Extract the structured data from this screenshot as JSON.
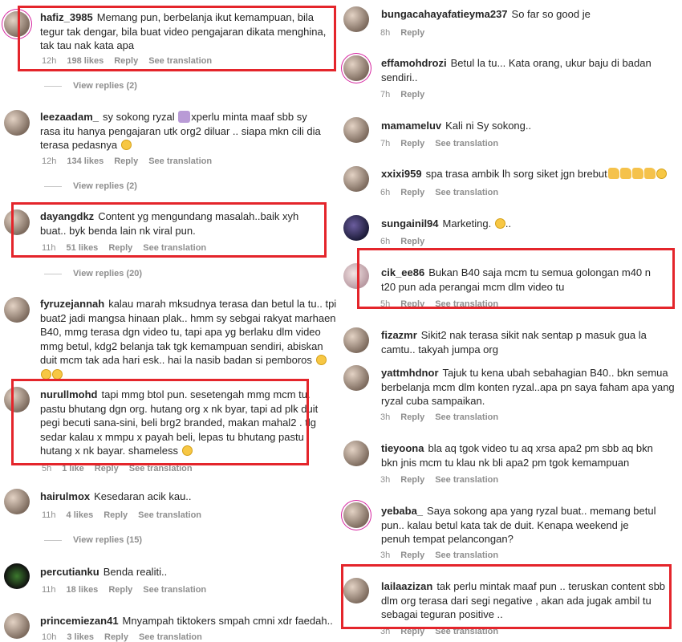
{
  "ui": {
    "reply": "Reply",
    "see_translation": "See translation",
    "view_replies_prefix": "View replies"
  },
  "left_column": [
    {
      "user": "hafiz_3985",
      "text": "Memang pun, berbelanja ikut kemampuan, bila tegur tak dengar, bila buat video pengajaran dikata menghina, tak tau nak kata apa",
      "time": "12h",
      "likes": "198 likes",
      "view_replies": "View replies (2)"
    },
    {
      "user": "leezaadam_",
      "text": "sy sokong ryzal",
      "text_b": "xperlu minta maaf sbb sy rasa itu hanya pengajaran utk org2 diluar .. siapa mkn cili dia terasa pedasnya",
      "time": "12h",
      "likes": "134 likes",
      "view_replies": "View replies (2)"
    },
    {
      "user": "dayangdkz",
      "text": "Content yg mengundang masalah..baik xyh buat.. byk benda lain nk viral pun.",
      "time": "11h",
      "likes": "51 likes",
      "view_replies": "View replies (20)"
    },
    {
      "user": "fyruzejannah",
      "text": "kalau marah mksudnya terasa dan betul la tu.. tpi buat2 jadi mangsa hinaan plak.. hmm sy sebgai rakyat marhaen B40, mmg terasa dgn video tu, tapi apa yg berlaku dlm video mmg betul, kdg2 belanja tak tgk kemampuan sendiri, abiskan duit mcm tak ada hari esk.. hai la nasib badan si pemboros"
    },
    {
      "user": "nurullmohd",
      "text": "tapi mmg btol pun. sesetengah mmg mcm tu. pastu bhutang dgn org. hutang org x nk byar, tapi ad plk duit pegi becuti sana-sini, beli brg2 branded, makan mahal2 . tlg sedar kalau x mmpu x payah beli, lepas tu bhutang pastu hutang x nk bayar. shameless",
      "time": "5h",
      "likes": "1 like",
      "view_replies": "View replies (15)"
    },
    {
      "user": "hairulmox",
      "text": "Kesedaran acik kau..",
      "time": "11h",
      "likes": "4 likes"
    },
    {
      "user": "percutianku",
      "text": "Benda realiti..",
      "time": "11h",
      "likes": "18 likes"
    },
    {
      "user": "princemiezan41",
      "text": "Mnyampah tiktokers smpah cmni xdr faedah..",
      "time": "10h",
      "likes": "3 likes"
    }
  ],
  "right_column": [
    {
      "user": "bungacahayafatieyma237",
      "text": "So far so good je",
      "time": "8h"
    },
    {
      "user": "effamohdrozi",
      "text": "Betul la tu... Kata orang, ukur baju di badan sendiri..",
      "time": "7h"
    },
    {
      "user": "mamameluv",
      "text": "Kali ni Sy sokong..",
      "time": "7h"
    },
    {
      "user": "xxixi959",
      "text": "spa trasa ambik lh sorg siket jgn brebut",
      "time": "6h"
    },
    {
      "user": "sungainil94",
      "text": "Marketing.",
      "text_b": "..",
      "time": "6h"
    },
    {
      "user": "cik_ee86",
      "text": "Bukan B40 saja mcm tu semua golongan m40 n t20 pun ada perangai mcm dlm video tu",
      "time": "5h"
    },
    {
      "user": "fizazmr",
      "text": "Sikit2 nak terasa sikit nak sentap p masuk gua la camtu.. takyah jumpa org"
    },
    {
      "user": "yattmhdnor",
      "text": "Tajuk tu kena ubah sebahagian B40.. bkn semua berbelanja mcm dlm konten ryzal..apa pn saya faham apa yang ryzal cuba sampaikan.",
      "time": "3h"
    },
    {
      "user": "tieyoona",
      "text": "bla aq tgok video tu aq xrsa apa2 pm sbb aq bkn bkn jnis mcm tu klau nk bli apa2 pm tgok kemampuan",
      "time": "3h"
    },
    {
      "user": "yebaba_",
      "text": "Saya sokong apa yang ryzal buat.. memang betul pun.. kalau betul kata tak de duit. Kenapa weekend je penuh tempat pelancongan?",
      "time": "3h"
    },
    {
      "user": "lailaazizan",
      "text": "tak perlu mintak maaf pun .. teruskan content sbb dlm org terasa dari segi negative , akan ada jugak ambil tu sebagai teguran positive ..",
      "time": "3h"
    }
  ],
  "colors": {
    "highlight": "#e4252b",
    "text": "#262626",
    "muted": "#8e8e8e"
  }
}
